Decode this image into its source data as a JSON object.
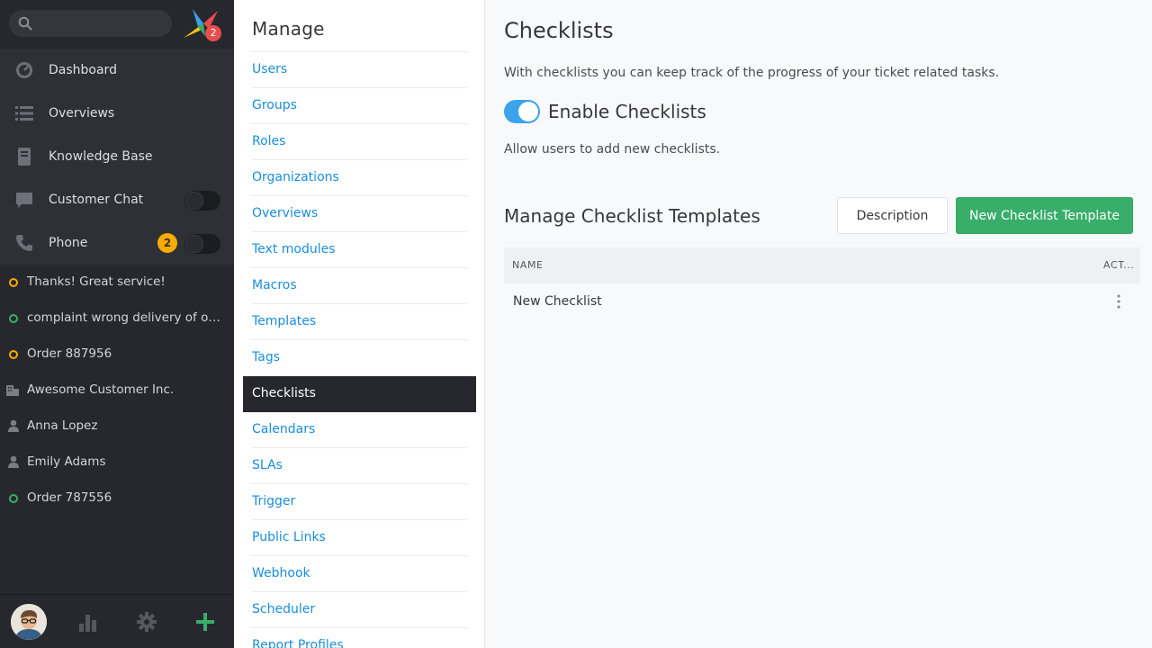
{
  "sidebar": {
    "search": {
      "placeholder": ""
    },
    "logo_badge": "2",
    "menu": [
      {
        "label": "Dashboard",
        "icon": "dashboard-icon"
      },
      {
        "label": "Overviews",
        "icon": "list-icon"
      },
      {
        "label": "Knowledge Base",
        "icon": "book-icon"
      },
      {
        "label": "Customer Chat",
        "icon": "chat-icon"
      },
      {
        "label": "Phone",
        "icon": "phone-icon",
        "badge": "2"
      }
    ],
    "tasks": [
      {
        "label": "Thanks! Great service!",
        "icon": "ticket-status-icon",
        "color": "#faab00"
      },
      {
        "label": "complaint wrong delivery of order",
        "icon": "ticket-status-icon",
        "color": "#38ae6a"
      },
      {
        "label": "Order 887956",
        "icon": "ticket-status-icon",
        "color": "#faab00"
      },
      {
        "label": "Awesome Customer Inc.",
        "icon": "organization-icon"
      },
      {
        "label": "Anna Lopez",
        "icon": "person-icon"
      },
      {
        "label": "Emily Adams",
        "icon": "person-icon"
      },
      {
        "label": "Order 787556",
        "icon": "ticket-status-icon",
        "color": "#38ae6a"
      }
    ]
  },
  "manage": {
    "title": "Manage",
    "items": [
      "Users",
      "Groups",
      "Roles",
      "Organizations",
      "Overviews",
      "Text modules",
      "Macros",
      "Templates",
      "Tags",
      "Checklists",
      "Calendars",
      "SLAs",
      "Trigger",
      "Public Links",
      "Webhook",
      "Scheduler",
      "Report Profiles"
    ],
    "active": "Checklists"
  },
  "content": {
    "title": "Checklists",
    "description": "With checklists you can keep track of the progress of your ticket related tasks.",
    "toggle_label": "Enable Checklists",
    "toggle_on": true,
    "help": "Allow users to add new checklists.",
    "section_title": "Manage Checklist Templates",
    "description_button": "Description",
    "new_button": "New Checklist Template",
    "table": {
      "columns": [
        "NAME",
        "ACT..."
      ],
      "rows": [
        {
          "name": "New Checklist"
        }
      ]
    }
  },
  "colors": {
    "accent": "#3ba2ec",
    "primary_button": "#38ae6a",
    "link": "#1a8ddb",
    "nav_background": "#27282d",
    "badge": "#faab00"
  }
}
